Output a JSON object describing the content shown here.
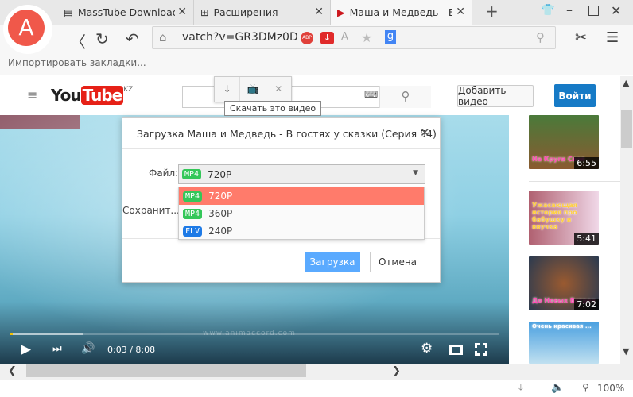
{
  "browser": {
    "tabs": [
      {
        "label": "MassTube Downloader",
        "active": false
      },
      {
        "label": "Расширения",
        "active": false
      },
      {
        "label": "Маша и Медведь - В гостях у сказки",
        "active": true
      }
    ],
    "new_tab": "+",
    "url": "vatch?v=GR3DMz0D",
    "abp_label": "ABP",
    "search_engine": "g",
    "bookmarks_import": "Импортировать закладки...",
    "zoom": "100%"
  },
  "youtube": {
    "region": "KZ",
    "logo_you": "You",
    "logo_tube": "Tube",
    "upload_label": "Добавить видео",
    "signin_label": "Войти",
    "tooltip": "Скачать это видео",
    "player": {
      "time": "0:03 / 8:08",
      "progress": 0.006,
      "buffered": 0.15,
      "watermark": "www.animaccord.com"
    },
    "related": [
      {
        "caption": "На Круги Своя",
        "duration": "6:55"
      },
      {
        "caption": "Ужасающая история про бабушку и внучка",
        "duration": "5:41"
      },
      {
        "caption": "До Новых Встреч",
        "duration": "7:02"
      },
      {
        "caption": "Очень красивая ...",
        "duration": ""
      }
    ]
  },
  "dialog": {
    "title": "Загрузка Маша и Медведь - В гостях у сказки (Серия 54)",
    "file_label": "Файл:",
    "save_label": "Сохранит...",
    "selected": {
      "format": "MP4",
      "quality": "720P"
    },
    "options": [
      {
        "format": "MP4",
        "quality": "720P",
        "highlighted": true
      },
      {
        "format": "MP4",
        "quality": "360P"
      },
      {
        "format": "FLV",
        "quality": "240P"
      }
    ],
    "download_label": "Загрузка",
    "cancel_label": "Отмена"
  },
  "colors": {
    "accent": "#f0584a",
    "mp4": "#34c759",
    "flv": "#1e7ae6",
    "highlight": "#ff7b6b",
    "primary": "#5aaaff",
    "yt_signin": "#167ac6"
  }
}
